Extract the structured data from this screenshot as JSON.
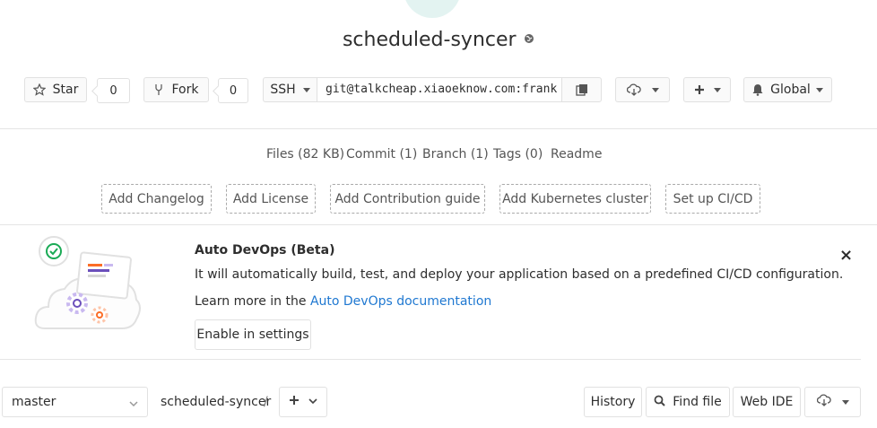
{
  "project": {
    "title": "scheduled-syncer",
    "visibility_icon": "globe-icon"
  },
  "actions": {
    "star_label": "Star",
    "star_count": "0",
    "fork_label": "Fork",
    "fork_count": "0",
    "clone_protocol": "SSH",
    "clone_url": "git@talkcheap.xiaoeknow.com:frank",
    "notification_label": "Global"
  },
  "stats": {
    "files": "Files (82 KB)",
    "commits": "Commit (1)",
    "branches": "Branch (1)",
    "tags": "Tags (0)",
    "readme": "Readme"
  },
  "quick_actions": {
    "changelog": "Add Changelog",
    "license": "Add License",
    "contribution": "Add Contribution guide",
    "kubernetes": "Add Kubernetes cluster",
    "cicd": "Set up CI/CD"
  },
  "autodevops": {
    "title": "Auto DevOps (Beta)",
    "description": "It will automatically build, test, and deploy your application based on a predefined CI/CD configuration.",
    "learn_prefix": "Learn more in the ",
    "learn_link": "Auto DevOps documentation",
    "enable_button": "Enable in settings",
    "close": "×"
  },
  "tree": {
    "branch": "master",
    "breadcrumb": "scheduled-syncer",
    "slash": "/",
    "history": "History",
    "find_file": "Find file",
    "web_ide": "Web IDE"
  },
  "colors": {
    "link": "#1f78d1",
    "border": "#e1e1e1",
    "accent_green": "#1aaa55",
    "illustration_purple": "#6b4fbb",
    "illustration_orange": "#fc6d26"
  }
}
